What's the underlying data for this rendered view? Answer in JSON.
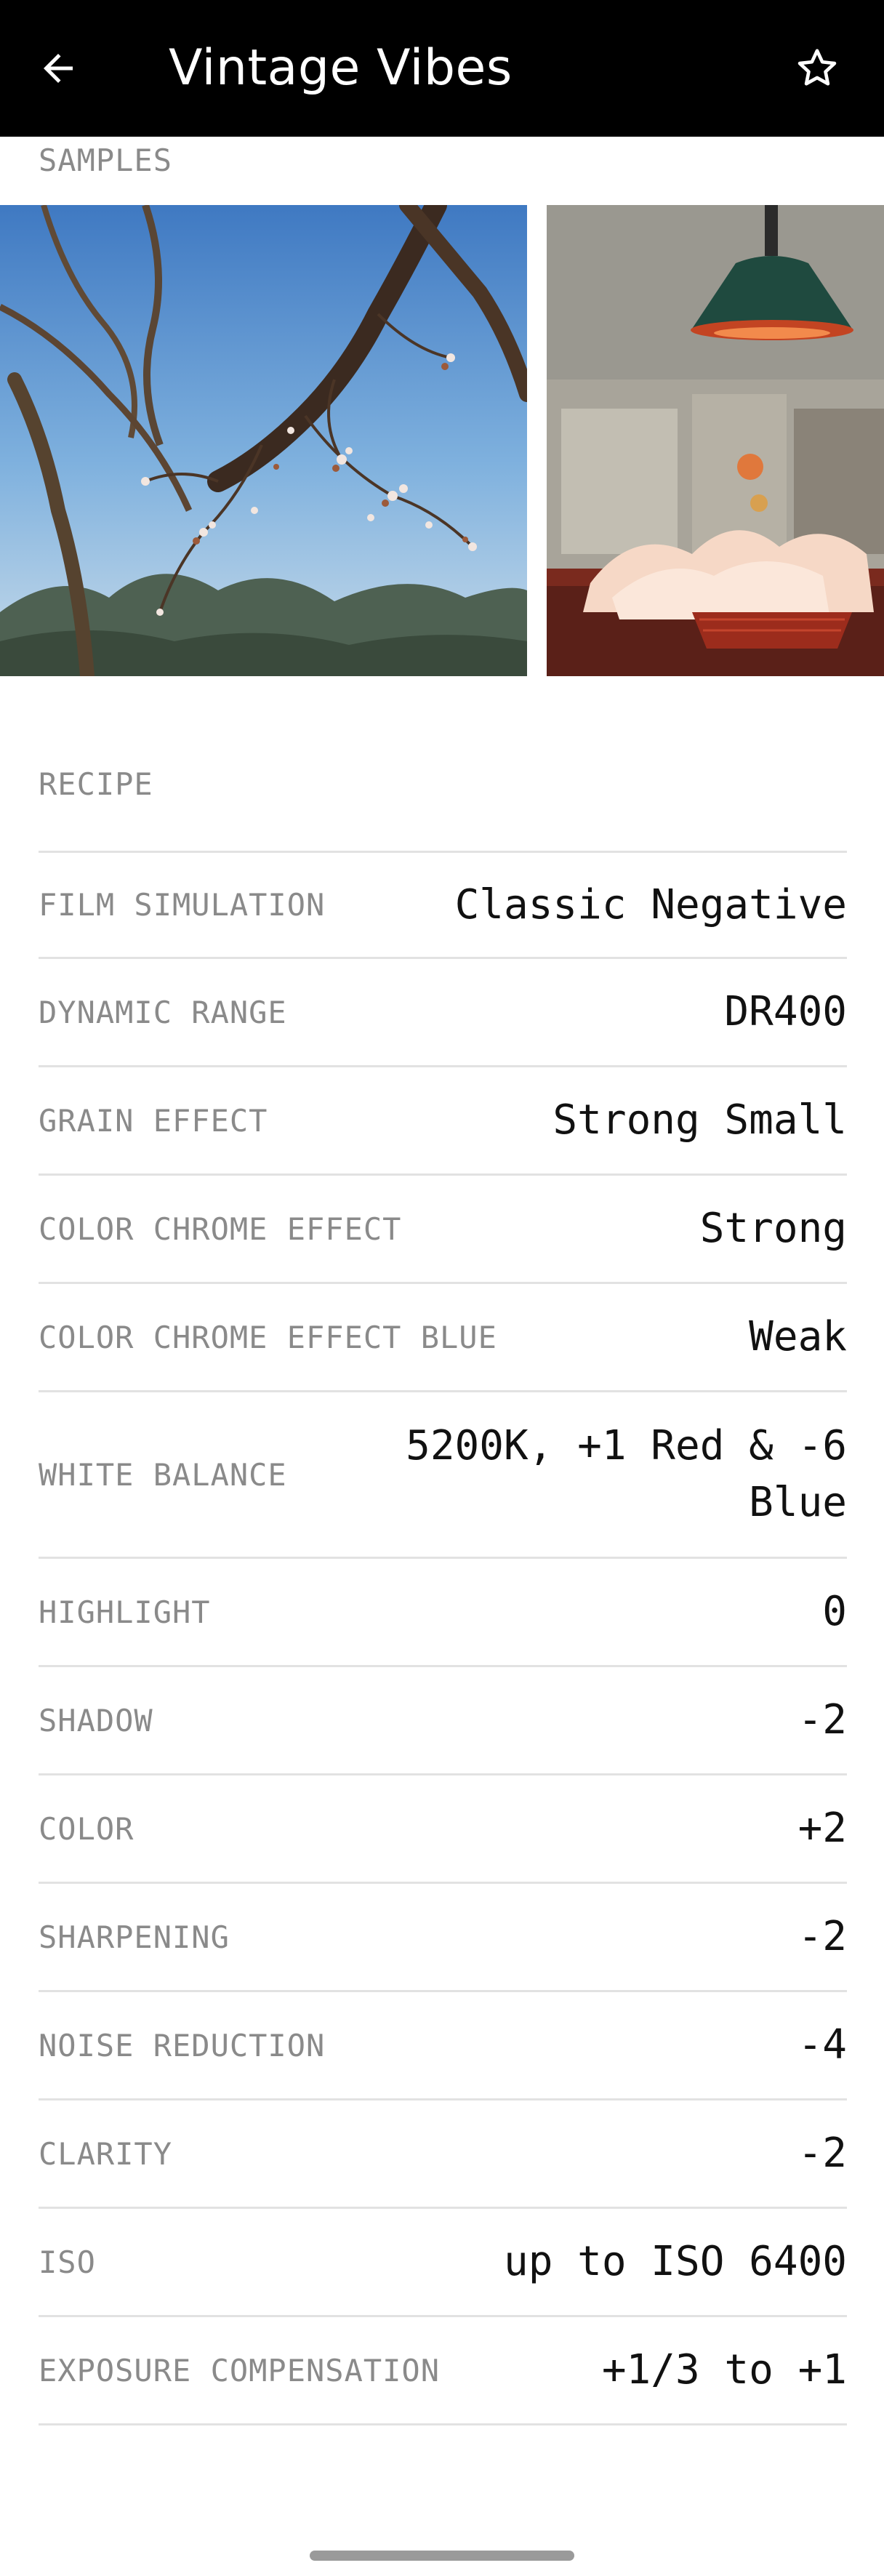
{
  "appbar": {
    "title": "Vintage Vibes",
    "back_icon": "arrow-left-icon",
    "favorite_icon": "star-outline-icon"
  },
  "samples": {
    "label": "SAMPLES",
    "images": [
      {
        "name": "sample-blossom-tree"
      },
      {
        "name": "sample-kitchen-lamp"
      }
    ]
  },
  "recipe": {
    "label": "RECIPE",
    "rows": [
      {
        "key": "FILM SIMULATION",
        "value": "Classic Negative"
      },
      {
        "key": "DYNAMIC RANGE",
        "value": "DR400"
      },
      {
        "key": "GRAIN EFFECT",
        "value": "Strong Small"
      },
      {
        "key": "COLOR CHROME EFFECT",
        "value": "Strong"
      },
      {
        "key": "COLOR CHROME EFFECT BLUE",
        "value": "Weak"
      },
      {
        "key": "WHITE BALANCE",
        "value": "5200K, +1 Red & -6 Blue"
      },
      {
        "key": "HIGHLIGHT",
        "value": "0"
      },
      {
        "key": "SHADOW",
        "value": "-2"
      },
      {
        "key": "COLOR",
        "value": "+2"
      },
      {
        "key": "SHARPENING",
        "value": "-2"
      },
      {
        "key": "NOISE REDUCTION",
        "value": "-4"
      },
      {
        "key": "CLARITY",
        "value": "-2"
      },
      {
        "key": "ISO",
        "value": "up to ISO 6400"
      },
      {
        "key": "EXPOSURE COMPENSATION",
        "value": "+1/3 to +1"
      }
    ]
  },
  "colors": {
    "appbar_bg": "#000000",
    "label_gray": "#8a8a8a",
    "divider": "#e2e2e2",
    "value_text": "#111111"
  }
}
